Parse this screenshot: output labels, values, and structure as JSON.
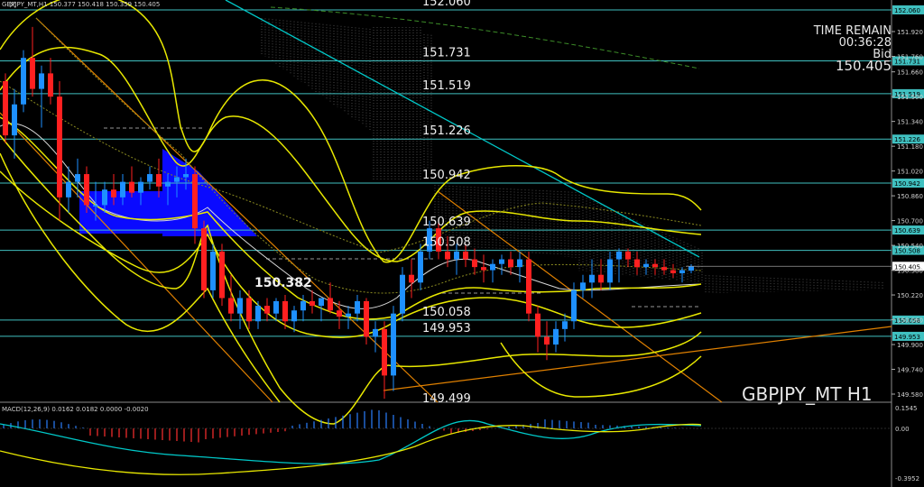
{
  "window": {
    "header": "GBPJPY_MT,H1  150.377 150.418 150.359 150.405",
    "symbol_label": "GBPJPY_MT H1",
    "macd_header": "MACD(12,26,9) 0.0162 0.0182 0.0000 -0.0020"
  },
  "info_panel": {
    "time_remain_label": "TIME REMAIN",
    "time_remain_value": "00:36:28",
    "bid_label": "Bid",
    "bid_value": "150.405"
  },
  "level_labels": [
    "152.060",
    "151.731",
    "151.519",
    "151.226",
    "150.942",
    "150.639",
    "150.508",
    "150.058",
    "149.953",
    "149.499"
  ],
  "current_price_marker": "150.382",
  "price_axis_ticks": [
    "151.920",
    "151.760",
    "151.660",
    "151.500",
    "151.340",
    "151.180",
    "151.020",
    "150.860",
    "150.700",
    "150.540",
    "150.380",
    "150.220",
    "150.060",
    "149.900",
    "149.740",
    "149.580"
  ],
  "level_badges": [
    "152.060",
    "151.731",
    "151.519",
    "151.226",
    "150.942",
    "150.639",
    "150.508",
    "150.058",
    "149.953"
  ],
  "bid_badge": "150.405",
  "macd_axis_ticks": [
    "0.1545",
    "0.00",
    "-0.3952"
  ],
  "colors": {
    "background": "#000000",
    "bull_candle": "#1e90ff",
    "bear_candle": "#ff2020",
    "bollinger": "#e8e800",
    "cyan_line": "#00c8c8",
    "orange_line": "#e08000",
    "level_line": "#40c0c0",
    "box_fill": "#0a0aff"
  },
  "chart_data": {
    "type": "candlestick",
    "symbol": "GBPJPY_MT",
    "timeframe": "H1",
    "ylim": [
      149.5,
      152.1
    ],
    "ohlc": [
      [
        151.6,
        151.65,
        151.2,
        151.25
      ],
      [
        151.25,
        151.55,
        151.1,
        151.45
      ],
      [
        151.45,
        151.8,
        151.4,
        151.75
      ],
      [
        151.75,
        151.95,
        151.5,
        151.55
      ],
      [
        151.55,
        151.7,
        151.3,
        151.65
      ],
      [
        151.65,
        151.75,
        151.45,
        151.5
      ],
      [
        151.5,
        151.6,
        150.7,
        150.85
      ],
      [
        150.85,
        151.05,
        150.75,
        150.95
      ],
      [
        150.95,
        151.1,
        150.85,
        151.0
      ],
      [
        151.0,
        151.05,
        150.75,
        150.8
      ],
      [
        150.8,
        150.95,
        150.7,
        150.8
      ],
      [
        150.8,
        150.95,
        150.75,
        150.9
      ],
      [
        150.9,
        151.0,
        150.8,
        150.85
      ],
      [
        150.85,
        151.0,
        150.8,
        150.95
      ],
      [
        150.95,
        151.05,
        150.85,
        150.88
      ],
      [
        150.88,
        150.98,
        150.8,
        150.95
      ],
      [
        150.95,
        151.05,
        150.9,
        151.0
      ],
      [
        151.0,
        151.1,
        150.85,
        150.92
      ],
      [
        150.92,
        151.0,
        150.8,
        150.95
      ],
      [
        150.95,
        151.05,
        150.85,
        150.98
      ],
      [
        150.98,
        151.1,
        150.9,
        151.0
      ],
      [
        151.0,
        151.05,
        150.55,
        150.65
      ],
      [
        150.65,
        150.7,
        150.2,
        150.25
      ],
      [
        150.25,
        150.55,
        150.2,
        150.5
      ],
      [
        150.5,
        150.55,
        150.15,
        150.2
      ],
      [
        150.2,
        150.35,
        150.05,
        150.1
      ],
      [
        150.1,
        150.25,
        150.0,
        150.2
      ],
      [
        150.2,
        150.25,
        150.0,
        150.05
      ],
      [
        150.05,
        150.18,
        150.0,
        150.15
      ],
      [
        150.15,
        150.2,
        150.05,
        150.1
      ],
      [
        150.1,
        150.2,
        150.05,
        150.18
      ],
      [
        150.18,
        150.22,
        150.0,
        150.05
      ],
      [
        150.05,
        150.15,
        149.98,
        150.12
      ],
      [
        150.12,
        150.22,
        150.05,
        150.18
      ],
      [
        150.18,
        150.25,
        150.1,
        150.15
      ],
      [
        150.15,
        150.2,
        150.05,
        150.2
      ],
      [
        150.2,
        150.3,
        150.1,
        150.12
      ],
      [
        150.12,
        150.18,
        150.0,
        150.08
      ],
      [
        150.08,
        150.15,
        150.0,
        150.1
      ],
      [
        150.1,
        150.22,
        150.05,
        150.18
      ],
      [
        150.18,
        150.2,
        149.9,
        149.95
      ],
      [
        149.95,
        150.05,
        149.85,
        150.0
      ],
      [
        150.0,
        150.05,
        149.55,
        149.7
      ],
      [
        149.7,
        150.15,
        149.6,
        150.1
      ],
      [
        150.1,
        150.4,
        150.05,
        150.35
      ],
      [
        150.35,
        150.45,
        150.2,
        150.3
      ],
      [
        150.3,
        150.55,
        150.25,
        150.5
      ],
      [
        150.5,
        150.7,
        150.45,
        150.65
      ],
      [
        150.65,
        150.7,
        150.45,
        150.5
      ],
      [
        150.5,
        150.6,
        150.4,
        150.45
      ],
      [
        150.45,
        150.55,
        150.35,
        150.5
      ],
      [
        150.5,
        150.55,
        150.4,
        150.45
      ],
      [
        150.45,
        150.52,
        150.35,
        150.4
      ],
      [
        150.4,
        150.48,
        150.3,
        150.38
      ],
      [
        150.38,
        150.45,
        150.3,
        150.42
      ],
      [
        150.42,
        150.48,
        150.35,
        150.45
      ],
      [
        150.45,
        150.5,
        150.35,
        150.4
      ],
      [
        150.4,
        150.5,
        150.3,
        150.45
      ],
      [
        150.45,
        150.5,
        150.05,
        150.1
      ],
      [
        150.1,
        150.15,
        149.85,
        149.95
      ],
      [
        149.95,
        150.05,
        149.8,
        149.9
      ],
      [
        149.9,
        150.05,
        149.85,
        150.0
      ],
      [
        150.0,
        150.1,
        149.92,
        150.05
      ],
      [
        150.05,
        150.3,
        150.0,
        150.25
      ],
      [
        150.25,
        150.35,
        150.2,
        150.3
      ],
      [
        150.3,
        150.45,
        150.2,
        150.35
      ],
      [
        150.35,
        150.45,
        150.25,
        150.3
      ],
      [
        150.3,
        150.5,
        150.25,
        150.45
      ],
      [
        150.45,
        150.52,
        150.3,
        150.5
      ],
      [
        150.5,
        150.52,
        150.4,
        150.45
      ],
      [
        150.45,
        150.5,
        150.35,
        150.4
      ],
      [
        150.4,
        150.45,
        150.35,
        150.42
      ],
      [
        150.42,
        150.45,
        150.35,
        150.4
      ],
      [
        150.4,
        150.45,
        150.35,
        150.38
      ],
      [
        150.38,
        150.42,
        150.33,
        150.36
      ],
      [
        150.36,
        150.4,
        150.3,
        150.38
      ],
      [
        150.377,
        150.418,
        150.359,
        150.405
      ]
    ]
  }
}
